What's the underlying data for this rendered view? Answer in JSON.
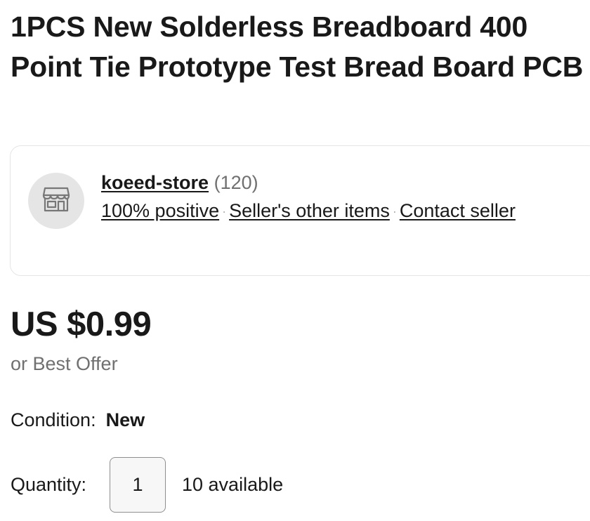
{
  "listing": {
    "title": "1PCS New Solderless Breadboard 400 Point Tie Prototype Test Bread Board PCB"
  },
  "seller": {
    "name": "koeed-store",
    "feedback_count": "(120)",
    "positive": "100% positive",
    "other_items": "Seller's other items",
    "contact": "Contact seller",
    "separator": "·",
    "avatar_icon": "store-icon"
  },
  "price": {
    "amount": "US $0.99",
    "best_offer": "or Best Offer"
  },
  "condition": {
    "label": "Condition:",
    "value": "New"
  },
  "quantity": {
    "label": "Quantity:",
    "value": "1",
    "available": "10 available"
  }
}
